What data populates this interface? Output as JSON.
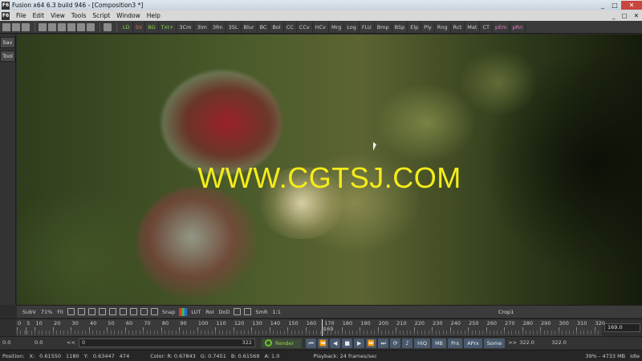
{
  "window": {
    "title": "Fusion x64 6.3 build 946 - [Composition3 *]",
    "app_badge": "F6",
    "controls": [
      "_",
      "□",
      "✕"
    ]
  },
  "menu": {
    "items": [
      "File",
      "Edit",
      "View",
      "Tools",
      "Script",
      "Window",
      "Help"
    ],
    "mdi_controls": [
      "_",
      "□",
      "✕"
    ]
  },
  "toolbar": {
    "tools": [
      "LD",
      "SV",
      "BG",
      "Txt+",
      "3Cm",
      "3Im",
      "3Rn",
      "3SL",
      "Blur",
      "BC",
      "Bol",
      "CC",
      "CCv",
      "HCv",
      "Mrg",
      "Log",
      "FLU",
      "Bmp",
      "BSp",
      "Elp",
      "Ply",
      "Rng",
      "Rct",
      "Mat",
      "CT",
      "pEm",
      "pRn"
    ]
  },
  "sidebar": {
    "tabs": [
      "Sav",
      "Tool"
    ]
  },
  "viewer": {
    "watermark": "WWW.CGTSJ.COM"
  },
  "viewbar": {
    "subview": "SubV",
    "zoom": "71%",
    "fit": "Fit",
    "snap": "Snap",
    "lut": "LUT",
    "roi": "RoI",
    "dod": "DoD",
    "smr": "SmR",
    "ratio": "1:1",
    "node_name": "Crop1"
  },
  "timeline": {
    "labels": [
      "0",
      "5",
      "10",
      "20",
      "30",
      "40",
      "50",
      "60",
      "70",
      "80",
      "90",
      "100",
      "110",
      "120",
      "130",
      "140",
      "150",
      "160",
      "170",
      "180",
      "190",
      "200",
      "210",
      "220",
      "230",
      "240",
      "250",
      "260",
      "270",
      "280",
      "290",
      "300",
      "310",
      "320"
    ],
    "current_frame": "169",
    "end_value": "169.0"
  },
  "transport": {
    "start_a": "0.0",
    "start_b": "0.0",
    "back": "<<",
    "range_start": "0",
    "range_end": "322",
    "render": "Render",
    "fwd": ">>",
    "end_a": "322.0",
    "end_b": "322.0",
    "buttons": [
      "HiQ",
      "MB",
      "Prx",
      "APrx",
      "Some"
    ]
  },
  "status": {
    "position": "Position:",
    "x_label": "X:",
    "x_value": "0.61550",
    "px_value": "1180",
    "y_label": "Y:",
    "y_value": "0.63447",
    "py_value": "474",
    "color": "Color: R: 0.67843",
    "g": "G: 0.7451",
    "b": "B: 0.61569",
    "a": "A: 1.0",
    "playback": "Playback: 24 frames/sec",
    "memory": "39% - 4733 MB",
    "state": "Idle"
  }
}
